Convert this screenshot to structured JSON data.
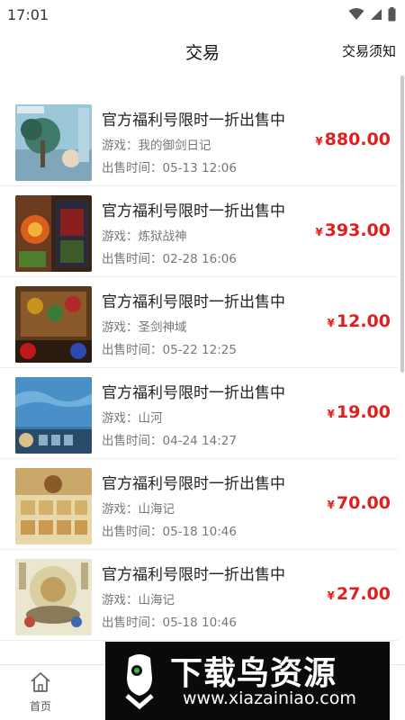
{
  "status_bar": {
    "time": "17:01"
  },
  "header": {
    "title": "交易",
    "action": "交易须知"
  },
  "currency_symbol": "¥",
  "listings": [
    {
      "title": "官方福利号限时一折出售中",
      "game": "游戏：我的御剑日记",
      "time": "出售时间：05-13 12:06",
      "price": "880.00",
      "thumb_icon": "game-screenshot-sword-diary"
    },
    {
      "title": "官方福利号限时一折出售中",
      "game": "游戏：炼狱战神",
      "time": "出售时间：02-28 16:06",
      "price": "393.00",
      "thumb_icon": "game-screenshot-inferno-god"
    },
    {
      "title": "官方福利号限时一折出售中",
      "game": "游戏：圣剑神域",
      "time": "出售时间：05-22 12:25",
      "price": "12.00",
      "thumb_icon": "game-screenshot-holy-sword"
    },
    {
      "title": "官方福利号限时一折出售中",
      "game": "游戏：山河",
      "time": "出售时间：04-24 14:27",
      "price": "19.00",
      "thumb_icon": "game-screenshot-shanhe"
    },
    {
      "title": "官方福利号限时一折出售中",
      "game": "游戏：山海记",
      "time": "出售时间：05-18 10:46",
      "price": "70.00",
      "thumb_icon": "game-screenshot-shanhaiji"
    },
    {
      "title": "官方福利号限时一折出售中",
      "game": "游戏：山海记",
      "time": "出售时间：05-18 10:46",
      "price": "27.00",
      "thumb_icon": "game-screenshot-shanhaiji-2"
    }
  ],
  "bottom_nav": {
    "home_label": "首页"
  },
  "watermark": {
    "brand": "下载鸟资源",
    "url": "www.xiazainiao.com"
  },
  "colors": {
    "price": "#e0201d",
    "text": "#222222",
    "muted": "#777777"
  }
}
